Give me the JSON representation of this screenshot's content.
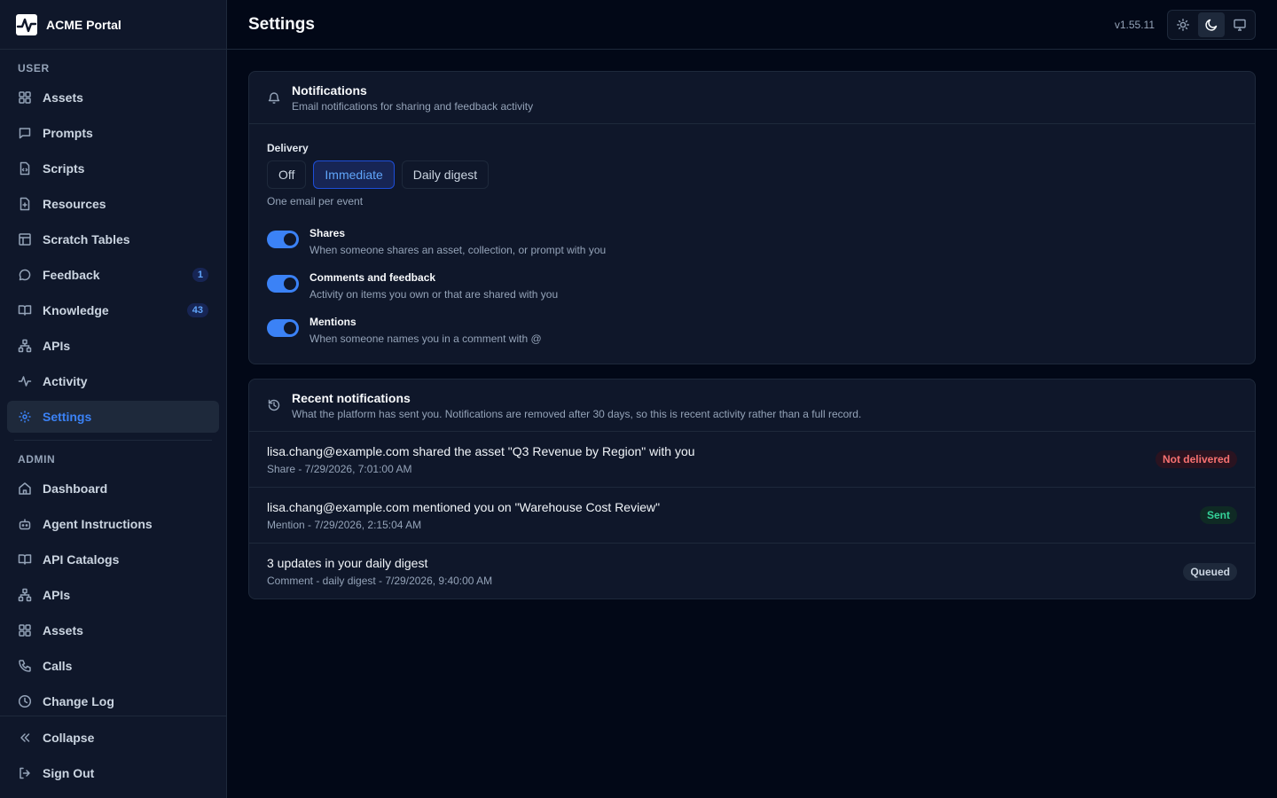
{
  "brand": {
    "name": "ACME Portal"
  },
  "header": {
    "title": "Settings",
    "version": "v1.55.11",
    "theme": {
      "active": "dark",
      "options": [
        "light-icon",
        "moon-icon",
        "monitor-icon"
      ]
    }
  },
  "sidebar": {
    "user_label": "USER",
    "admin_label": "ADMIN",
    "user_items": [
      {
        "label": "Assets",
        "icon": "grid-icon"
      },
      {
        "label": "Prompts",
        "icon": "message-square-icon"
      },
      {
        "label": "Scripts",
        "icon": "file-code-icon"
      },
      {
        "label": "Resources",
        "icon": "file-icon"
      },
      {
        "label": "Scratch Tables",
        "icon": "table-icon"
      },
      {
        "label": "Feedback",
        "icon": "message-circle-icon",
        "badge": "1"
      },
      {
        "label": "Knowledge",
        "icon": "book-icon",
        "badge": "43"
      },
      {
        "label": "APIs",
        "icon": "network-icon"
      },
      {
        "label": "Activity",
        "icon": "activity-icon"
      },
      {
        "label": "Settings",
        "icon": "gear-icon",
        "active": true
      }
    ],
    "admin_items": [
      {
        "label": "Dashboard",
        "icon": "home-icon"
      },
      {
        "label": "Agent Instructions",
        "icon": "bot-icon"
      },
      {
        "label": "API Catalogs",
        "icon": "book-icon"
      },
      {
        "label": "APIs",
        "icon": "network-icon"
      },
      {
        "label": "Assets",
        "icon": "grid-icon"
      },
      {
        "label": "Calls",
        "icon": "phone-icon"
      },
      {
        "label": "Change Log",
        "icon": "clock-icon"
      }
    ],
    "collapse_label": "Collapse",
    "signout_label": "Sign Out"
  },
  "notifications": {
    "title": "Notifications",
    "subtitle": "Email notifications for sharing and feedback activity",
    "delivery_label": "Delivery",
    "delivery_options": [
      "Off",
      "Immediate",
      "Daily digest"
    ],
    "delivery_selected": "Immediate",
    "delivery_hint": "One email per event",
    "toggles": [
      {
        "title": "Shares",
        "desc": "When someone shares an asset, collection, or prompt with you",
        "on": true
      },
      {
        "title": "Comments and feedback",
        "desc": "Activity on items you own or that are shared with you",
        "on": true
      },
      {
        "title": "Mentions",
        "desc": "When someone names you in a comment with @",
        "on": true
      }
    ]
  },
  "recent": {
    "title": "Recent notifications",
    "subtitle": "What the platform has sent you. Notifications are removed after 30 days, so this is recent activity rather than a full record.",
    "items": [
      {
        "text": "lisa.chang@example.com shared the asset \"Q3 Revenue by Region\" with you",
        "meta": "Share - 7/29/2026, 7:01:00 AM",
        "status": "Not delivered",
        "status_kind": "failed"
      },
      {
        "text": "lisa.chang@example.com mentioned you on \"Warehouse Cost Review\"",
        "meta": "Mention - 7/29/2026, 2:15:04 AM",
        "status": "Sent",
        "status_kind": "sent"
      },
      {
        "text": "3 updates in your daily digest",
        "meta": "Comment - daily digest - 7/29/2026, 9:40:00 AM",
        "status": "Queued",
        "status_kind": "queued"
      }
    ]
  },
  "colors": {
    "accent": "#3b82f6",
    "background": "#020817",
    "surface": "#0f172a",
    "border": "#1e293b"
  }
}
